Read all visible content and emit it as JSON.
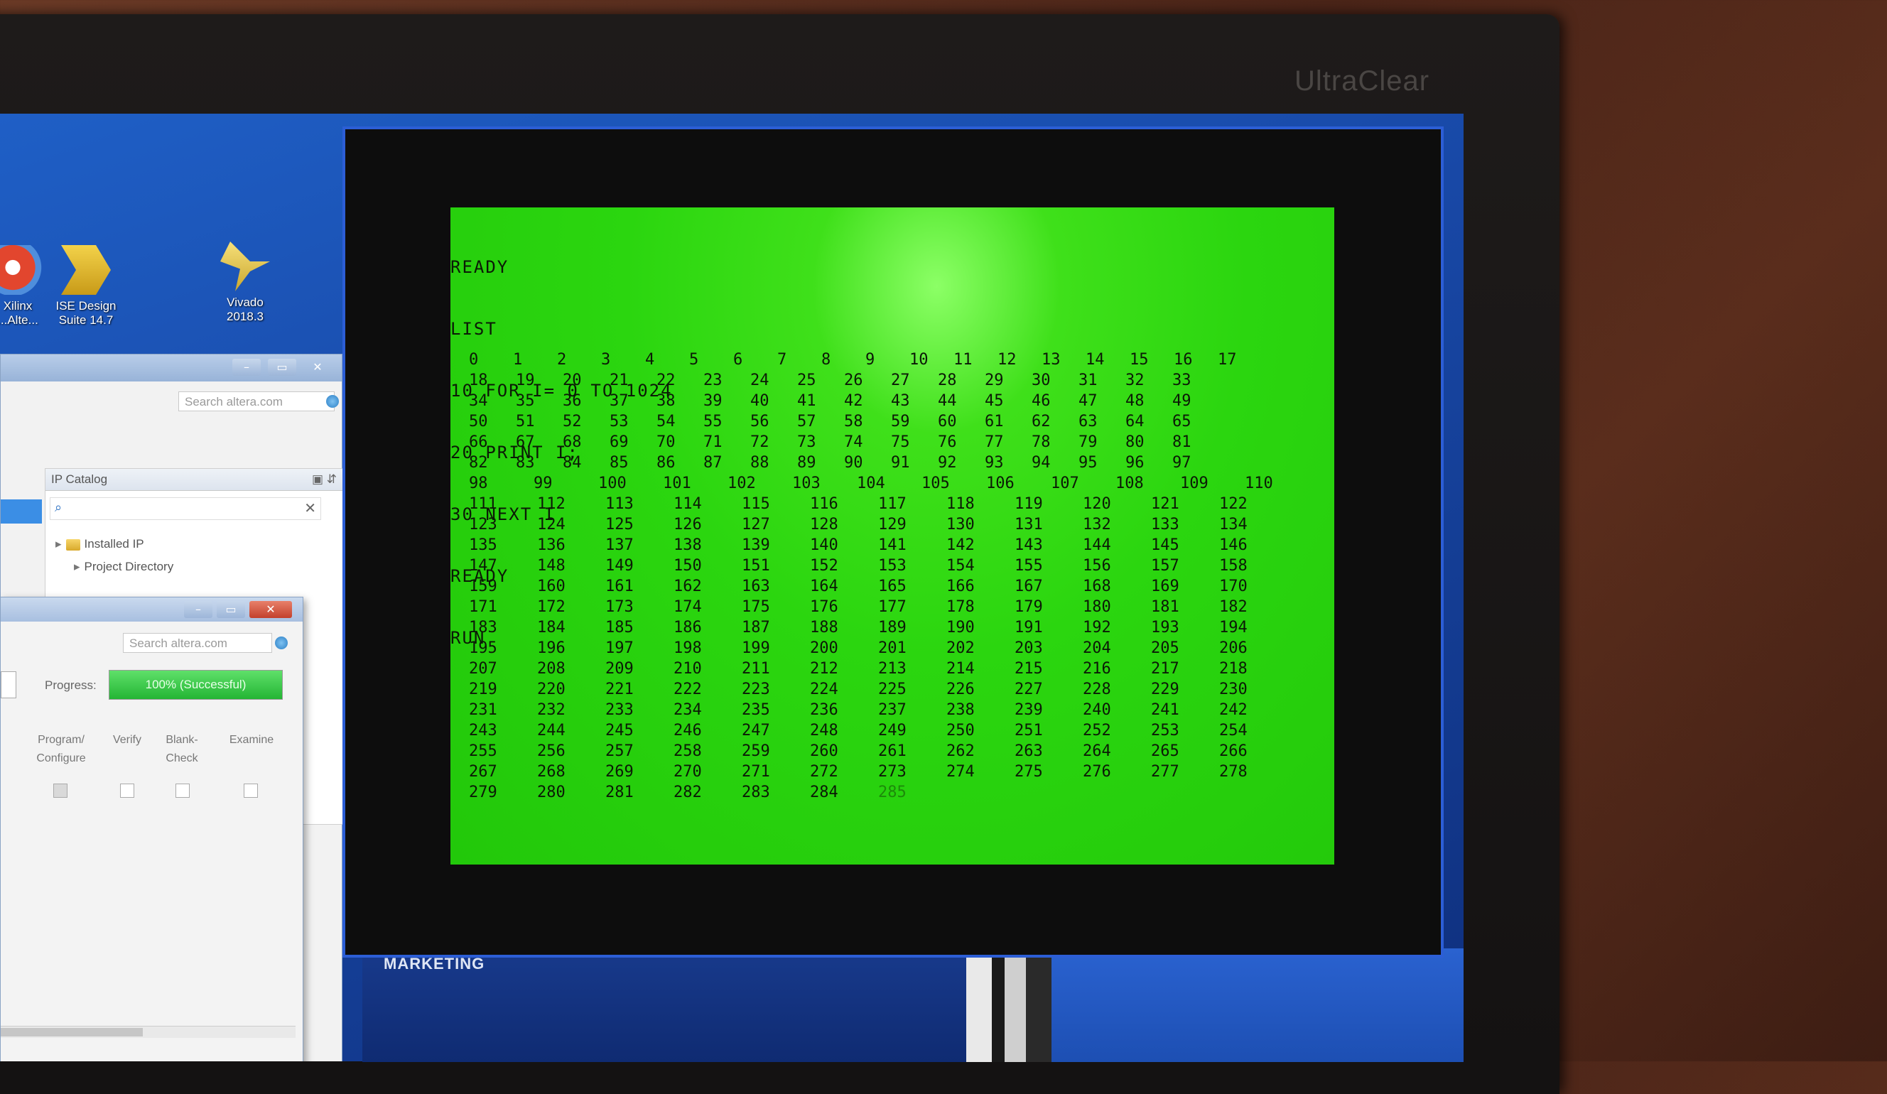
{
  "monitor": {
    "brand": "UltraClear"
  },
  "desktop_icons": [
    {
      "name": "xilinx",
      "label": "Xilinx\n...Alte..."
    },
    {
      "name": "ise",
      "label": "ISE Design\nSuite 14.7"
    },
    {
      "name": "vivado",
      "label": "Vivado\n2018.3"
    }
  ],
  "back_window": {
    "search_placeholder": "Search altera.com",
    "panel_title": "IP Catalog",
    "tree": [
      "Installed IP",
      "Project Directory"
    ]
  },
  "front_window": {
    "search_placeholder": "Search altera.com",
    "progress_label": "Progress:",
    "progress_text": "100% (Successful)",
    "progress_value": 100,
    "columns": [
      "Program/\nConfigure",
      "Verify",
      "Blank-\nCheck",
      "Examine"
    ]
  },
  "taskbar": {
    "label": "MARKETING"
  },
  "terminal": {
    "lines": [
      "READY",
      "LIST",
      "10 FOR I= 0 TO 1024",
      "20 PRINT I;",
      "30 NEXT I",
      "READY",
      "RUN"
    ],
    "output_rows": [
      [
        "0",
        "1",
        "2",
        "3",
        "4",
        "5",
        "6",
        "7",
        "8",
        "9",
        "10",
        "11",
        "12",
        "13",
        "14",
        "15",
        "16",
        "17"
      ],
      [
        "18",
        "19",
        "20",
        "21",
        "22",
        "23",
        "24",
        "25",
        "26",
        "27",
        "28",
        "29",
        "30",
        "31",
        "32",
        "33"
      ],
      [
        "34",
        "35",
        "36",
        "37",
        "38",
        "39",
        "40",
        "41",
        "42",
        "43",
        "44",
        "45",
        "46",
        "47",
        "48",
        "49"
      ],
      [
        "50",
        "51",
        "52",
        "53",
        "54",
        "55",
        "56",
        "57",
        "58",
        "59",
        "60",
        "61",
        "62",
        "63",
        "64",
        "65"
      ],
      [
        "66",
        "67",
        "68",
        "69",
        "70",
        "71",
        "72",
        "73",
        "74",
        "75",
        "76",
        "77",
        "78",
        "79",
        "80",
        "81"
      ],
      [
        "82",
        "83",
        "84",
        "85",
        "86",
        "87",
        "88",
        "89",
        "90",
        "91",
        "92",
        "93",
        "94",
        "95",
        "96",
        "97"
      ],
      [
        "98",
        "99",
        "100",
        "101",
        "102",
        "103",
        "104",
        "105",
        "106",
        "107",
        "108",
        "109",
        "110"
      ],
      [
        "111",
        "112",
        "113",
        "114",
        "115",
        "116",
        "117",
        "118",
        "119",
        "120",
        "121",
        "122"
      ],
      [
        "123",
        "124",
        "125",
        "126",
        "127",
        "128",
        "129",
        "130",
        "131",
        "132",
        "133",
        "134"
      ],
      [
        "135",
        "136",
        "137",
        "138",
        "139",
        "140",
        "141",
        "142",
        "143",
        "144",
        "145",
        "146"
      ],
      [
        "147",
        "148",
        "149",
        "150",
        "151",
        "152",
        "153",
        "154",
        "155",
        "156",
        "157",
        "158"
      ],
      [
        "159",
        "160",
        "161",
        "162",
        "163",
        "164",
        "165",
        "166",
        "167",
        "168",
        "169",
        "170"
      ],
      [
        "171",
        "172",
        "173",
        "174",
        "175",
        "176",
        "177",
        "178",
        "179",
        "180",
        "181",
        "182"
      ],
      [
        "183",
        "184",
        "185",
        "186",
        "187",
        "188",
        "189",
        "190",
        "191",
        "192",
        "193",
        "194"
      ],
      [
        "195",
        "196",
        "197",
        "198",
        "199",
        "200",
        "201",
        "202",
        "203",
        "204",
        "205",
        "206"
      ],
      [
        "207",
        "208",
        "209",
        "210",
        "211",
        "212",
        "213",
        "214",
        "215",
        "216",
        "217",
        "218"
      ],
      [
        "219",
        "220",
        "221",
        "222",
        "223",
        "224",
        "225",
        "226",
        "227",
        "228",
        "229",
        "230"
      ],
      [
        "231",
        "232",
        "233",
        "234",
        "235",
        "236",
        "237",
        "238",
        "239",
        "240",
        "241",
        "242"
      ],
      [
        "243",
        "244",
        "245",
        "246",
        "247",
        "248",
        "249",
        "250",
        "251",
        "252",
        "253",
        "254"
      ],
      [
        "255",
        "256",
        "257",
        "258",
        "259",
        "260",
        "261",
        "262",
        "263",
        "264",
        "265",
        "266"
      ],
      [
        "267",
        "268",
        "269",
        "270",
        "271",
        "272",
        "273",
        "274",
        "275",
        "276",
        "277",
        "278"
      ],
      [
        "279",
        "280",
        "281",
        "282",
        "283",
        "284",
        "285"
      ]
    ]
  }
}
